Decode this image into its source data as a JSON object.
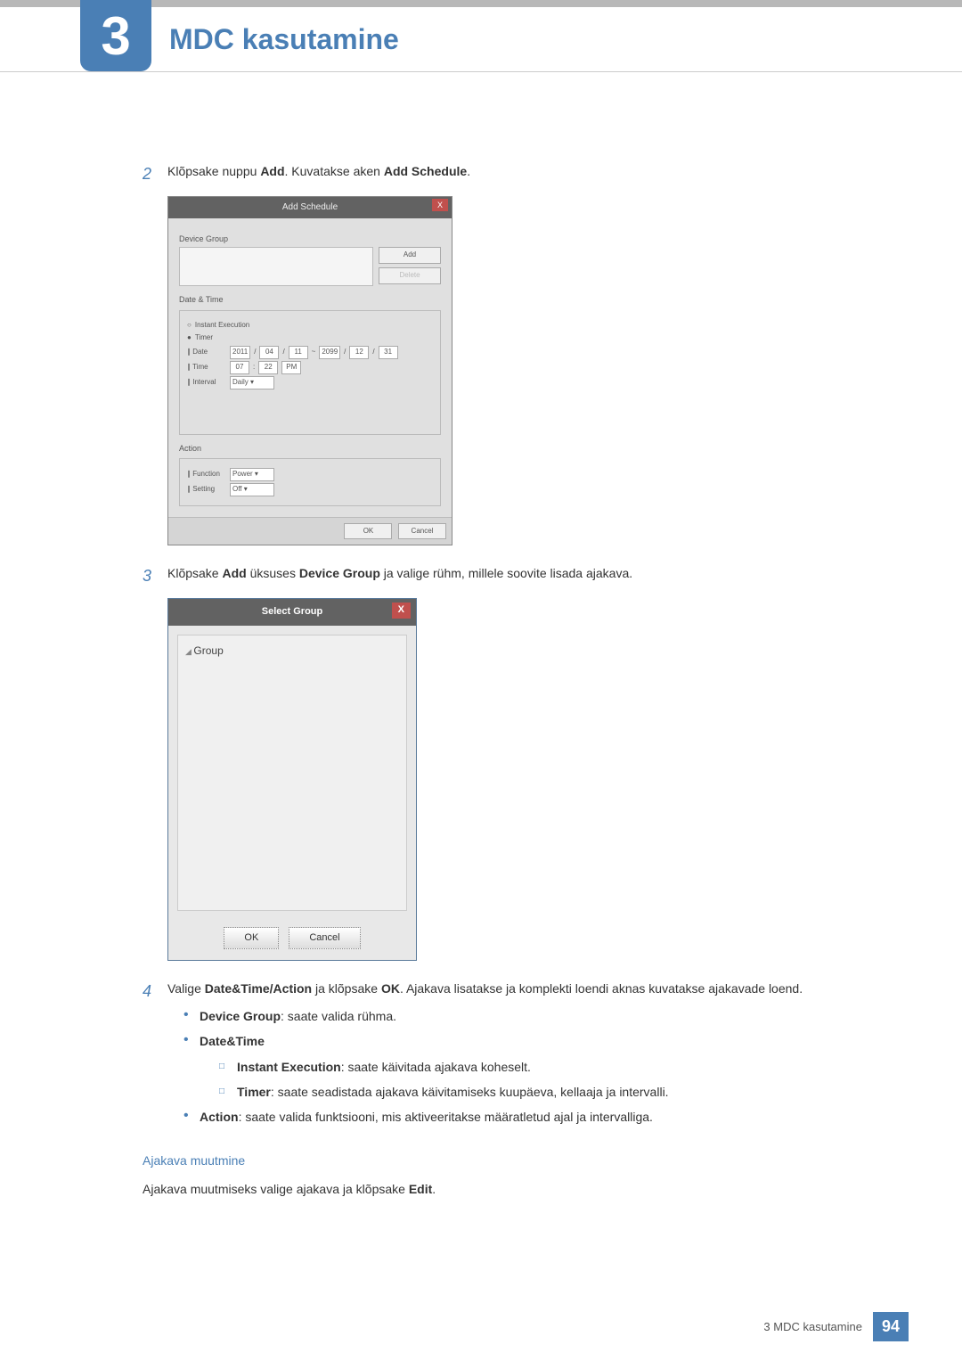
{
  "chapter": {
    "number": "3",
    "title": "MDC kasutamine"
  },
  "steps": {
    "s2": {
      "num": "2",
      "pre": "Klõpsake nuppu ",
      "b1": "Add",
      "mid": ". Kuvatakse aken ",
      "b2": "Add Schedule",
      "post": "."
    },
    "s3": {
      "num": "3",
      "pre": "Klõpsake ",
      "b1": "Add",
      "mid": " üksuses ",
      "b2": "Device Group",
      "post": " ja valige rühm, millele soovite lisada ajakava."
    },
    "s4": {
      "num": "4",
      "pre": "Valige ",
      "b1": "Date&Time/Action",
      "mid": " ja klõpsake ",
      "b2": "OK",
      "post": ". Ajakava lisatakse ja komplekti loendi aknas kuvatakse ajakavade loend."
    }
  },
  "dlg1": {
    "title": "Add Schedule",
    "section_device_group": "Device Group",
    "btn_add": "Add",
    "btn_delete": "Delete",
    "section_date_time": "Date & Time",
    "radio_instant": "Instant Execution",
    "radio_timer": "Timer",
    "lbl_date": "∥ Date",
    "date_from_y": "2011",
    "date_from_m": "04",
    "date_from_d": "11",
    "tilde": "~",
    "date_to_y": "2099",
    "date_to_m": "12",
    "date_to_d": "31",
    "lbl_time": "∥ Time",
    "time_h": "07",
    "time_m": "22",
    "time_ap": "PM",
    "lbl_interval": "∥ Interval",
    "interval_val": "Daily",
    "section_action": "Action",
    "lbl_function": "∥ Function",
    "function_val": "Power",
    "lbl_setting": "∥ Setting",
    "setting_val": "Off",
    "btn_ok": "OK",
    "btn_cancel": "Cancel"
  },
  "dlg2": {
    "title": "Select Group",
    "tree_root": "Group",
    "btn_ok": "OK",
    "btn_cancel": "Cancel"
  },
  "bullets": {
    "dg_b": "Device Group",
    "dg_t": ": saate valida rühma.",
    "dt_b": "Date&Time",
    "ie_b": "Instant Execution",
    "ie_t": ": saate käivitada ajakava koheselt.",
    "tm_b": "Timer",
    "tm_t": ": saate seadistada ajakava käivitamiseks kuupäeva, kellaaja ja intervalli.",
    "ac_b": "Action",
    "ac_t": ": saate valida funktsiooni, mis aktiveeritakse määratletud ajal ja intervalliga."
  },
  "subhead": "Ajakava muutmine",
  "subhead_text_pre": "Ajakava muutmiseks valige ajakava ja klõpsake ",
  "subhead_text_b": "Edit",
  "subhead_text_post": ".",
  "footer": {
    "label": "3 MDC kasutamine",
    "page": "94"
  }
}
